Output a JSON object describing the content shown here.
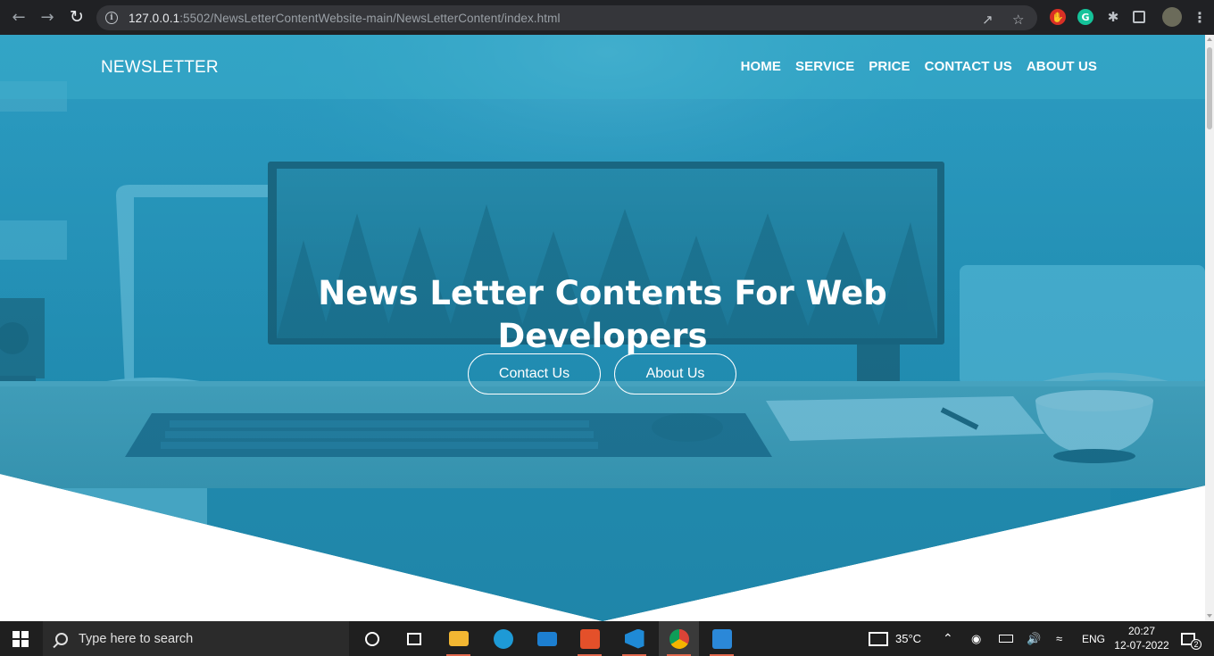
{
  "browser": {
    "url_host": "127.0.0.1",
    "url_rest": ":5502/NewsLetterContentWebsite-main/NewsLetterContent/index.html"
  },
  "site": {
    "brand": "NEWSLETTER",
    "menu": [
      {
        "label": "HOME"
      },
      {
        "label": "SERVICE"
      },
      {
        "label": "PRICE"
      },
      {
        "label": "CONTACT US"
      },
      {
        "label": "ABOUT US"
      }
    ],
    "hero": {
      "headline": "News Letter Contents For Web Developers",
      "buttons": [
        {
          "label": "Contact Us"
        },
        {
          "label": "About Us"
        }
      ]
    }
  },
  "taskbar": {
    "search_placeholder": "Type here to search",
    "weather": "35°C",
    "language": "ENG",
    "time": "20:27",
    "date": "12-07-2022",
    "notification_count": "2"
  },
  "colors": {
    "hero_tint": "#2a9cc2",
    "navbar_overlay": "#3cafcd",
    "chrome_bg": "#202124",
    "taskbar_bg": "#1f1f1f"
  }
}
